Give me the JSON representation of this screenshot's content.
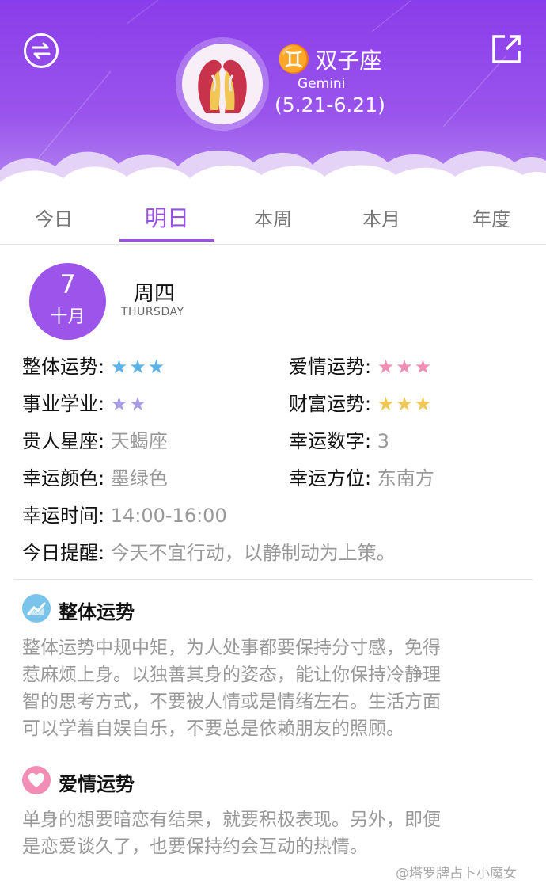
{
  "header": {
    "sign_glyph": "♊",
    "sign_name": "双子座",
    "sign_en": "Gemini",
    "sign_dates": "(5.21-6.21)"
  },
  "tabs": [
    {
      "label": "今日",
      "active": false
    },
    {
      "label": "明日",
      "active": true
    },
    {
      "label": "本周",
      "active": false
    },
    {
      "label": "本月",
      "active": false
    },
    {
      "label": "年度",
      "active": false
    }
  ],
  "date": {
    "day": "7",
    "month": "十月",
    "weekday": "周四",
    "weekday_en": "THURSDAY"
  },
  "info": {
    "overall": {
      "label": "整体运势:",
      "stars": 3,
      "color": "#5ab4ea"
    },
    "love": {
      "label": "爱情运势:",
      "stars": 3,
      "color": "#f28db5"
    },
    "career": {
      "label": "事业学业:",
      "stars": 2,
      "color": "#a99be6"
    },
    "wealth": {
      "label": "财富运势:",
      "stars": 3,
      "color": "#f2c653"
    },
    "noble": {
      "label": "贵人星座:",
      "value": "天蝎座"
    },
    "lucky_number": {
      "label": "幸运数字:",
      "value": "3"
    },
    "lucky_color": {
      "label": "幸运颜色:",
      "value": "墨绿色"
    },
    "lucky_direction": {
      "label": "幸运方位:",
      "value": "东南方"
    },
    "lucky_time": {
      "label": "幸运时间:",
      "value": "14:00-16:00"
    },
    "reminder": {
      "label": "今日提醒:",
      "value": "今天不宜行动，以静制动为上策。"
    }
  },
  "sections": {
    "overall": {
      "title": "整体运势",
      "icon": "trend-chart-icon",
      "lines": [
        "整体运势中规中矩，为人处事都要保持分寸感，免得",
        "惹麻烦上身。以独善其身的姿态，能让你保持冷静理",
        "智的思考方式，不要被人情或是情绪左右。生活方面",
        "可以学着自娱自乐，不要总是依赖朋友的照顾。"
      ]
    },
    "love": {
      "title": "爱情运势",
      "icon": "heart-icon",
      "lines": [
        "单身的想要暗恋有结果，就要积极表现。另外，即便",
        "是恋爱谈久了，也要保持约会互动的热情。"
      ]
    }
  },
  "watermark": "@塔罗牌占卜小魔女"
}
